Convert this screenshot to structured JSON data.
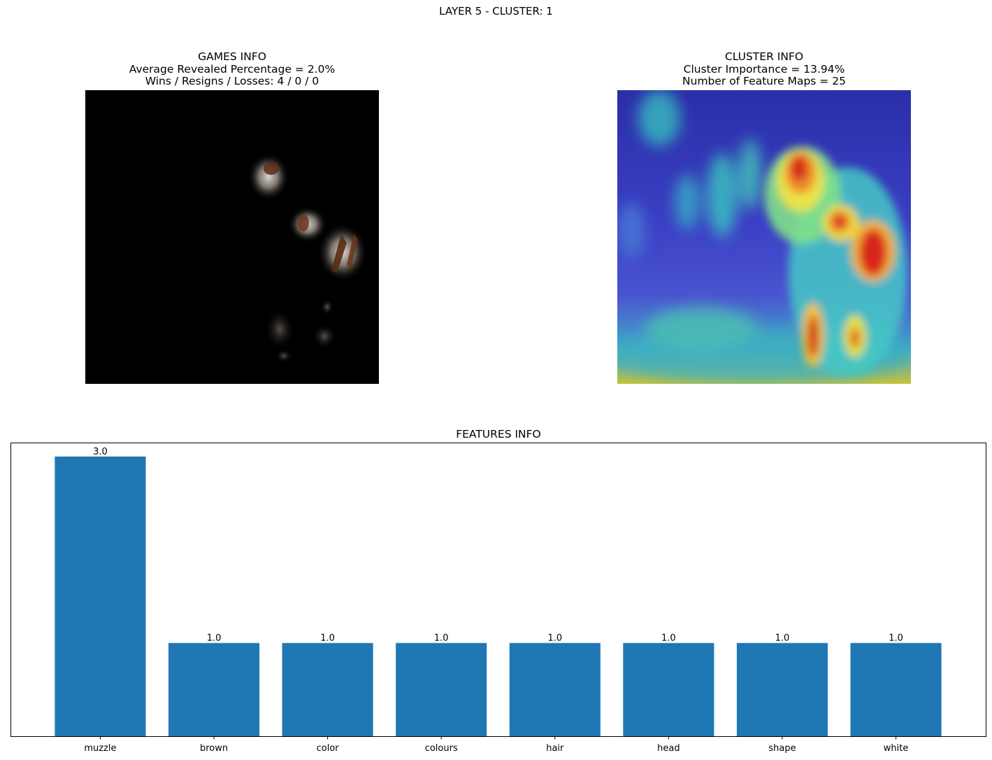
{
  "suptitle": "LAYER 5 - CLUSTER: 1",
  "games_panel": {
    "line1": "GAMES INFO",
    "line2": "Average Revealed Percentage = 2.0%",
    "line3": "Wins / Resigns / Losses: 4 / 0 / 0"
  },
  "cluster_panel": {
    "line1": "CLUSTER INFO",
    "line2": "Cluster Importance = 13.94%",
    "line3": "Number of Feature Maps = 25"
  },
  "features_title": "FEATURES INFO",
  "chart_data": {
    "type": "bar",
    "title": "FEATURES INFO",
    "categories": [
      "muzzle",
      "brown",
      "color",
      "colours",
      "hair",
      "head",
      "shape",
      "white"
    ],
    "values": [
      3.0,
      1.0,
      1.0,
      1.0,
      1.0,
      1.0,
      1.0,
      1.0
    ],
    "value_labels": [
      "3.0",
      "1.0",
      "1.0",
      "1.0",
      "1.0",
      "1.0",
      "1.0",
      "1.0"
    ],
    "ylim": [
      0,
      3.15
    ],
    "grid": false,
    "show_y_axis": false,
    "bar_color": "#1f77b4"
  }
}
